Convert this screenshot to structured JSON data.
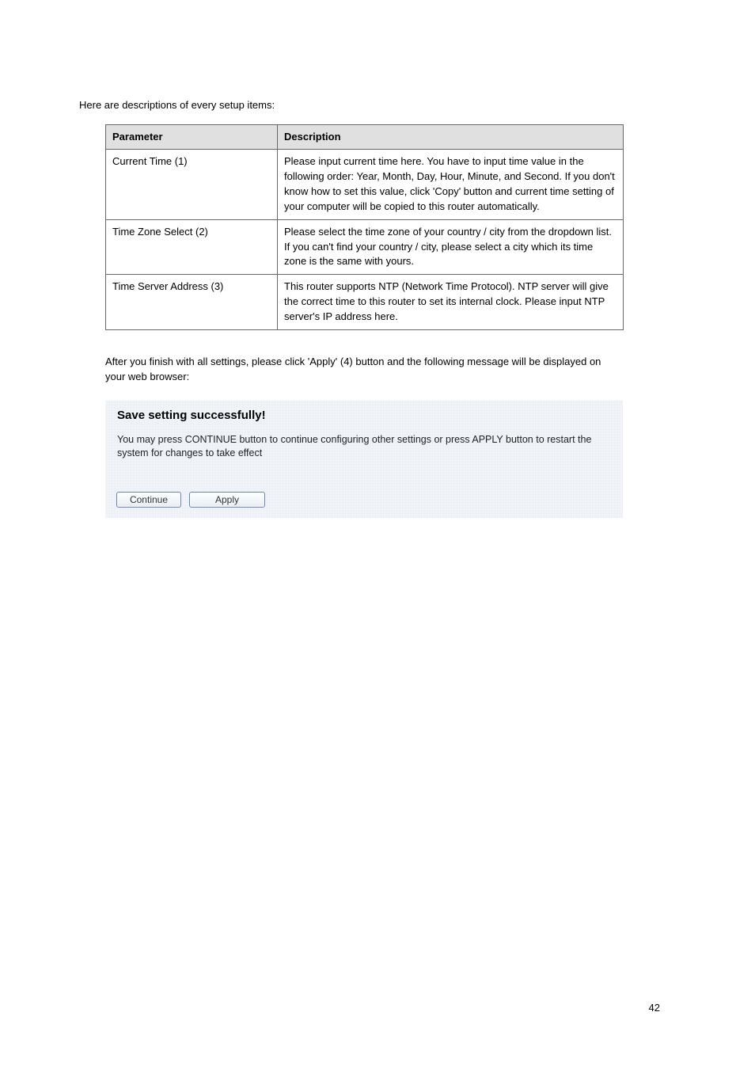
{
  "intro": "Here are descriptions of every setup items:",
  "table": {
    "headers": [
      "Parameter",
      "Description"
    ],
    "rows": [
      {
        "param": "Current Time (1)",
        "desc": "Please input current time here. You have to input time value in the following order: Year, Month, Day, Hour, Minute, and Second. If you don't know how to set this value, click 'Copy' button and current time setting of your computer will be copied to this router automatically."
      },
      {
        "param": "Time Zone Select (2)",
        "desc": "Please select the time zone of your country / city from the dropdown list. If you can't find your country / city, please select a city which its time zone is the same with yours."
      },
      {
        "param": "Time Server Address (3)",
        "desc": "This router supports NTP (Network Time Protocol). NTP server will give the correct time to this router to set its internal clock. Please input NTP server's IP address here."
      }
    ]
  },
  "after_table": "After you finish with all settings, please click 'Apply' (4) button and the following message will be displayed on your web browser:",
  "dialog": {
    "title": "Save setting successfully!",
    "body": "You may press CONTINUE button to continue configuring other settings or press APPLY button to restart the system for changes to take effect",
    "continue_label": "Continue",
    "apply_label": "Apply"
  },
  "page_number": "42"
}
